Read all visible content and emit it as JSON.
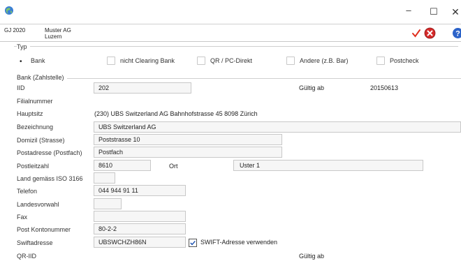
{
  "window": {
    "minimize_glyph": "–",
    "maximize_glyph": "☐",
    "close_glyph": "✕"
  },
  "header": {
    "fiscal_year": "GJ 2020",
    "company": "Muster AG",
    "city": "Luzern"
  },
  "typ": {
    "title": "Typ",
    "options": [
      {
        "label": "Bank",
        "selected": true
      },
      {
        "label": "nicht Clearing Bank",
        "checked": false
      },
      {
        "label": "QR / PC-Direkt",
        "checked": false
      },
      {
        "label": "Andere (z.B. Bar)",
        "checked": false
      },
      {
        "label": "Postcheck",
        "checked": false
      }
    ]
  },
  "bank": {
    "title": "Bank (Zahlstelle)",
    "iid_label": "IID",
    "iid_value": "202",
    "gueltig_label": "Gültig ab",
    "gueltig_value": "20150613",
    "filialnummer_label": "Filialnummer",
    "hauptsitz_label": "Hauptsitz",
    "hauptsitz_value": "(230) UBS Switzerland AG Bahnhofstrasse 45 8098 Zürich",
    "bezeichnung_label": "Bezeichnung",
    "bezeichnung_value": "UBS Switzerland AG",
    "domizil_label": "Domizil (Strasse)",
    "domizil_value": "Poststrasse 10",
    "postadresse_label": "Postadresse (Postfach)",
    "postadresse_value": "Postfach",
    "plz_label": "Postleitzahl",
    "plz_value": "8610",
    "ort_label": "Ort",
    "ort_value": "Uster 1",
    "land_label": "Land gemäss ISO 3166",
    "land_value": "",
    "telefon_label": "Telefon",
    "telefon_value": "044 944 91 11",
    "landesvorwahl_label": "Landesvorwahl",
    "landesvorwahl_value": "",
    "fax_label": "Fax",
    "fax_value": "",
    "postkonto_label": "Post Kontonummer",
    "postkonto_value": "80-2-2",
    "swift_label": "Swiftadresse",
    "swift_value": "UBSWCHZH86N",
    "swift_checkbox_label": "SWIFT-Adresse verwenden",
    "swift_checked": true,
    "qriid_label": "QR-IID",
    "qr_gueltig_label": "Gültig ab"
  },
  "colors": {
    "accent_check": "#e0301e",
    "cancel_red": "#d42a2a",
    "help_blue": "#2c63c9"
  }
}
